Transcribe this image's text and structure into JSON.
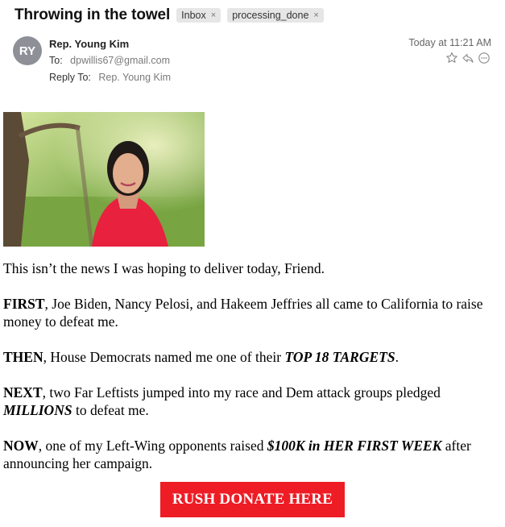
{
  "email": {
    "subject": "Throwing in the towel",
    "tags": [
      {
        "label": "Inbox",
        "remove": "×"
      },
      {
        "label": "processing_done",
        "remove": "×"
      }
    ],
    "sender_initials": "RY",
    "sender_name": "Rep. Young Kim",
    "to_label": "To:",
    "to_value": "dpwillis67@gmail.com",
    "reply_to_label": "Reply To:",
    "reply_to_value": "Rep. Young Kim",
    "timestamp": "Today at 11:21 AM",
    "action_icons": [
      "star-icon",
      "reply-icon",
      "more-icon"
    ]
  },
  "body": {
    "p1": "This isn’t the news I was hoping to deliver today, Friend.",
    "p2_lead": "FIRST",
    "p2_text": ", Joe Biden, Nancy Pelosi, and Hakeem Jeffries all came to California to raise money to defeat me.",
    "p3_lead": "THEN",
    "p3_text": ", House Democrats named me one of their ",
    "p3_emph": "TOP 18 TARGETS",
    "p3_end": ".",
    "p4_lead": "NEXT",
    "p4_text": ", two Far Leftists jumped into my race and Dem attack groups pledged ",
    "p4_emph": "MILLIONS",
    "p4_end": " to defeat me.",
    "p5_lead": "NOW",
    "p5_text": ", one of my Left-Wing opponents raised ",
    "p5_emph": "$100K in HER FIRST WEEK",
    "p5_end": " after announcing her campaign.",
    "donate_label": "RUSH DONATE HERE"
  },
  "colors": {
    "donate_bg": "#ee1c25",
    "avatar_bg": "#8e9097",
    "tag_bg": "#e6e6e6"
  }
}
